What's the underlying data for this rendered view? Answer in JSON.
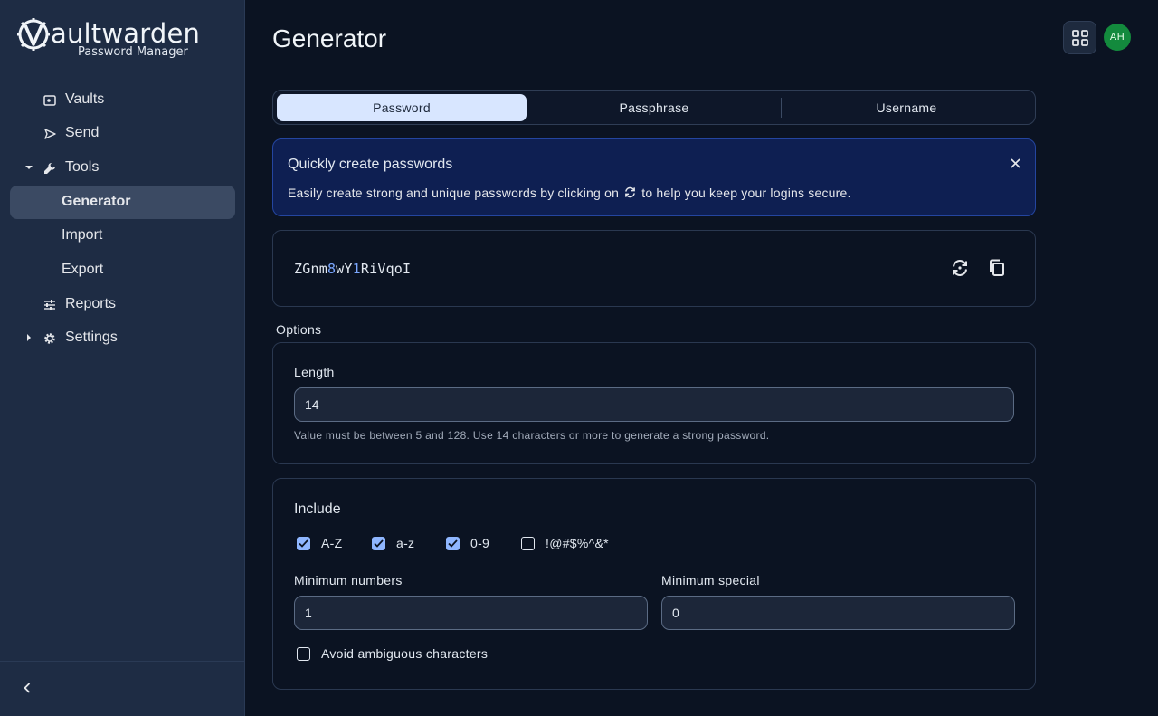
{
  "app": {
    "logo_text": "aultwarden",
    "logo_subtitle": "Password Manager"
  },
  "sidebar": {
    "items": [
      {
        "label": "Vaults",
        "icon": "vault-icon"
      },
      {
        "label": "Send",
        "icon": "send-icon"
      },
      {
        "label": "Tools",
        "icon": "wrench-icon",
        "expanded": true
      },
      {
        "label": "Generator",
        "active": true
      },
      {
        "label": "Import"
      },
      {
        "label": "Export"
      },
      {
        "label": "Reports",
        "icon": "sliders-icon"
      },
      {
        "label": "Settings",
        "icon": "gear-icon",
        "expanded": false
      }
    ]
  },
  "header": {
    "title": "Generator",
    "avatar_initials": "AH"
  },
  "tabs": [
    {
      "label": "Password",
      "active": true
    },
    {
      "label": "Passphrase",
      "active": false
    },
    {
      "label": "Username",
      "active": false
    }
  ],
  "callout": {
    "title": "Quickly create passwords",
    "text_before": "Easily create strong and unique passwords by clicking on",
    "text_after": "to help you keep your logins secure."
  },
  "password": {
    "part1": "ZGnm",
    "part2": "8",
    "part3": "wY",
    "part4": "1",
    "part5": "RiVqoI"
  },
  "options": {
    "section_label": "Options",
    "length_label": "Length",
    "length_value": "14",
    "length_hint": "Value must be between 5 and 128. Use 14 characters or more to generate a strong password.",
    "include_title": "Include",
    "checkboxes": [
      {
        "label": "A-Z",
        "checked": true
      },
      {
        "label": "a-z",
        "checked": true
      },
      {
        "label": "0-9",
        "checked": true
      },
      {
        "label": "!@#$%^&*",
        "checked": false
      }
    ],
    "min_numbers_label": "Minimum numbers",
    "min_numbers_value": "1",
    "min_special_label": "Minimum special",
    "min_special_value": "0",
    "avoid_ambiguous_label": "Avoid ambiguous characters",
    "avoid_ambiguous_checked": false
  },
  "colors": {
    "accent": "#8fb6ff",
    "avatar_bg": "#138a3d",
    "active_tab_bg": "#d8e6ff"
  }
}
